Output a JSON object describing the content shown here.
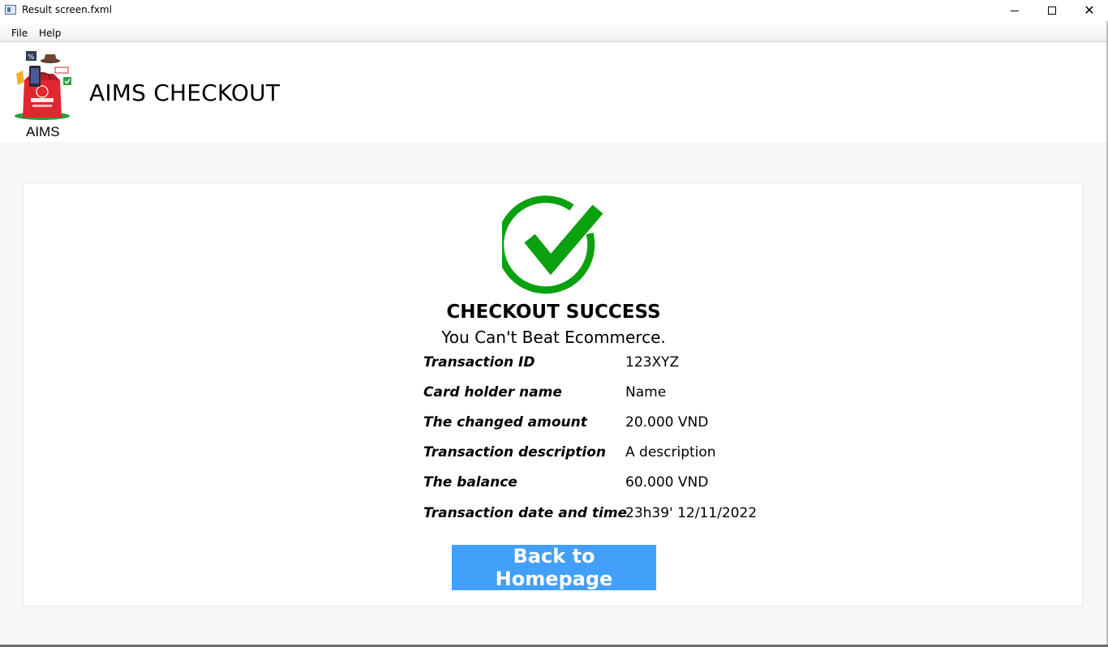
{
  "window": {
    "title": "Result screen.fxml",
    "icon": "app-window-icon",
    "controls": {
      "minimize_icon": "minimize-icon",
      "maximize_icon": "maximize-icon",
      "close_glyph": "✕"
    }
  },
  "menubar": {
    "items": [
      {
        "label": "File"
      },
      {
        "label": "Help"
      }
    ]
  },
  "header": {
    "logo_caption": "AIMS",
    "title": "AIMS CHECKOUT"
  },
  "result": {
    "status_icon": "check-circle-icon",
    "title": "CHECKOUT SUCCESS",
    "subtitle": "You Can't Beat Ecommerce.",
    "details": [
      {
        "label": "Transaction ID",
        "value": "123XYZ"
      },
      {
        "label": "Card holder name",
        "value": "Name"
      },
      {
        "label": "The changed amount",
        "value": "20.000 VND"
      },
      {
        "label": "Transaction description",
        "value": "A description"
      },
      {
        "label": "The balance",
        "value": "60.000 VND"
      },
      {
        "label": "Transaction date and time",
        "value": "23h39' 12/11/2022"
      }
    ],
    "back_button_label": "Back to Homepage"
  },
  "colors": {
    "success_green": "#09a10f",
    "button_blue": "#42a0fa",
    "content_bg": "#f7f7f7"
  }
}
